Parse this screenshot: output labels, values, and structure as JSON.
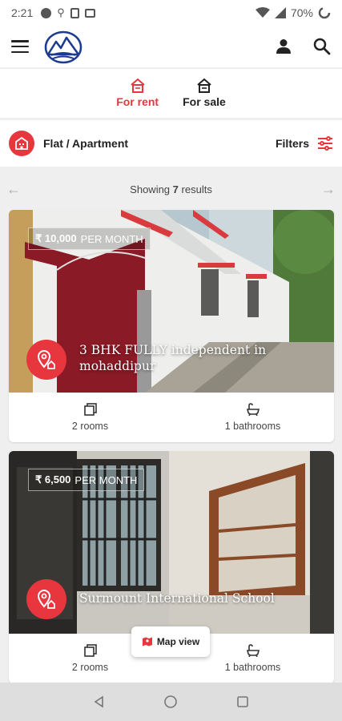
{
  "status": {
    "time": "2:21",
    "battery": "70%"
  },
  "appbar": {
    "menu_icon": "hamburger-icon",
    "logo": "mountain-logo",
    "user_icon": "user-icon",
    "search_icon": "search-icon"
  },
  "type_tabs": [
    {
      "label": "For rent",
      "icon": "house-icon",
      "color": "#e8363f"
    },
    {
      "label": "For sale",
      "icon": "house-icon",
      "color": "#222222"
    }
  ],
  "category": {
    "label": "Flat / Apartment",
    "filters_label": "Filters",
    "accent": "#e8363f"
  },
  "results": {
    "prefix": "Showing",
    "count": "7",
    "suffix": "results"
  },
  "listings": [
    {
      "price": "₹ 10,000",
      "period": "PER MONTH",
      "title": "3 BHK FULLY independent in mohaddipur",
      "rooms": "2 rooms",
      "bathrooms": "1 bathrooms"
    },
    {
      "price": "₹ 6,500",
      "period": "PER MONTH",
      "title": "Surmount International School",
      "rooms": "2 rooms",
      "bathrooms": "1 bathrooms"
    }
  ],
  "map_view": {
    "label": "Map view"
  }
}
